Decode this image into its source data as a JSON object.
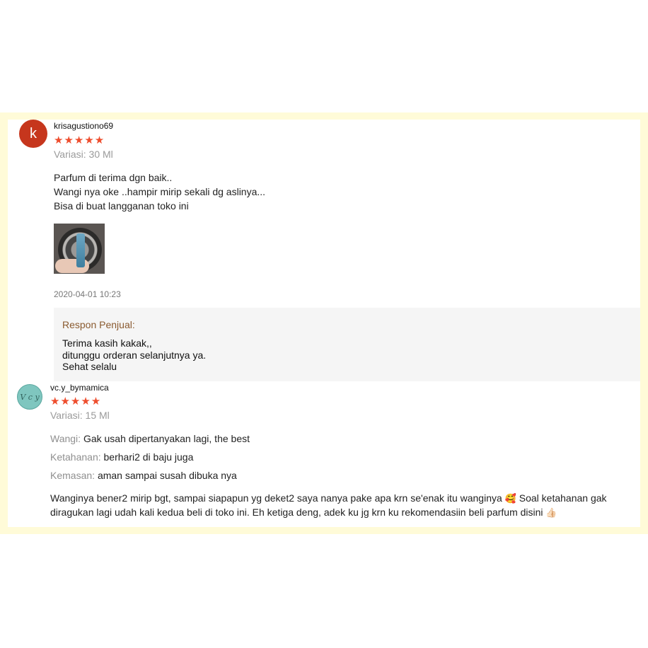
{
  "reviews": [
    {
      "username": "krisagustiono69",
      "avatar_letter": "k",
      "rating_stars": "★★★★★",
      "rating": 5,
      "variant": "Variasi: 30 Ml",
      "comment_lines": [
        "Parfum di terima dgn baik..",
        "Wangi nya oke ..hampir mirip sekali dg aslinya...",
        "Bisa di buat langganan toko ini"
      ],
      "date": "2020-04-01 10:23",
      "seller_response": {
        "title": "Respon Penjual:",
        "lines": [
          "Terima kasih kakak,,",
          "ditunggu orderan selanjutnya ya.",
          "Sehat selalu"
        ]
      }
    },
    {
      "username": "vc.y_bymamica",
      "rating_stars": "★★★★★",
      "rating": 5,
      "variant": "Variasi: 15 Ml",
      "attributes": [
        {
          "label": "Wangi:",
          "value": "Gak usah dipertanyakan lagi, the best"
        },
        {
          "label": "Ketahanan:",
          "value": "berhari2 di baju juga"
        },
        {
          "label": "Kemasan:",
          "value": "aman sampai susah dibuka nya"
        }
      ],
      "comment_line1": "Wanginya bener2 mirip bgt, sampai siapapun yg deket2 saya nanya pake apa krn se'enak itu wanginya",
      "emoji1": "🥰",
      "comment_line1_end": "Soal ketahanan gak",
      "comment_line2": "diragukan lagi udah kali kedua beli di toko ini. Eh ketiga deng, adek ku jg krn ku rekomendasiin beli parfum disini",
      "emoji2": "👍🏻"
    }
  ]
}
